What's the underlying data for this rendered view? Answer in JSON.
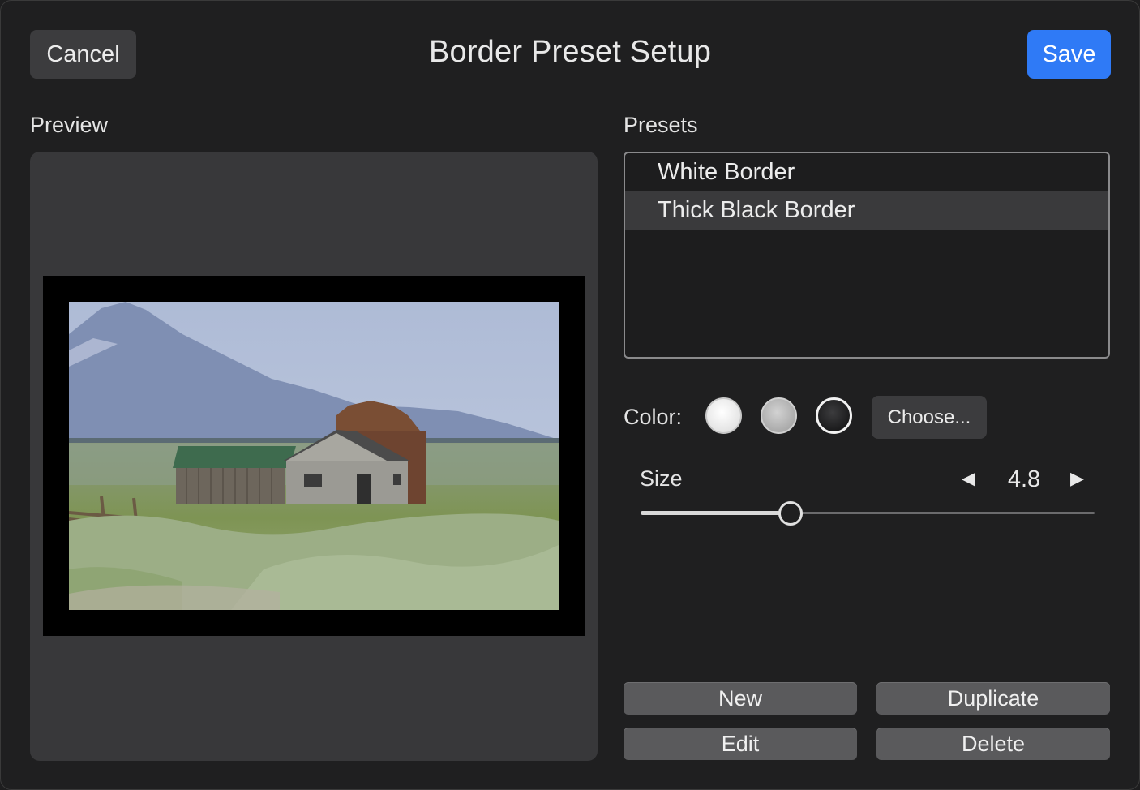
{
  "dialog": {
    "title": "Border Preset Setup",
    "cancel_label": "Cancel",
    "save_label": "Save",
    "accent_color": "#2f7af6"
  },
  "preview": {
    "label": "Preview",
    "border_color": "#000000"
  },
  "presets": {
    "label": "Presets",
    "items": [
      {
        "label": "White Border",
        "selected": false
      },
      {
        "label": "Thick Black Border",
        "selected": true
      }
    ]
  },
  "color": {
    "label": "Color:",
    "swatches": [
      {
        "name": "white",
        "hex": "#ffffff"
      },
      {
        "name": "gray",
        "hex": "#b8b8b8"
      },
      {
        "name": "black",
        "hex": "#111111",
        "selected": true
      }
    ],
    "choose_label": "Choose..."
  },
  "size": {
    "label": "Size",
    "value": "4.8",
    "slider_fraction": 0.33,
    "decrement_icon": "triangle-left-icon",
    "increment_icon": "triangle-right-icon"
  },
  "actions": {
    "new_label": "New",
    "duplicate_label": "Duplicate",
    "edit_label": "Edit",
    "delete_label": "Delete"
  }
}
